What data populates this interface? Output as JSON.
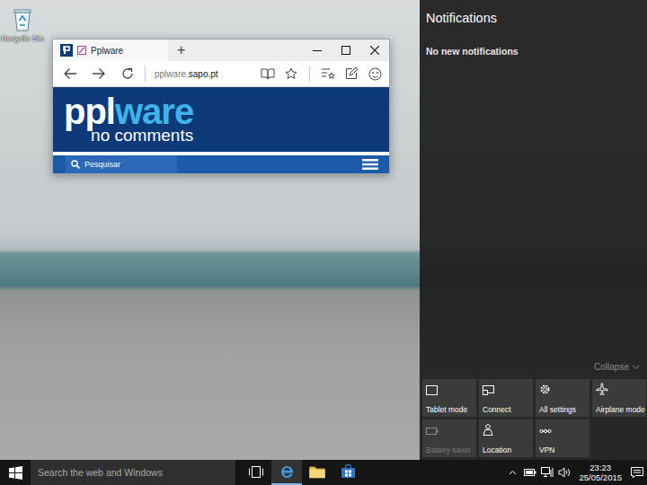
{
  "desktop": {
    "icons": [
      {
        "label": "Recycle Bin"
      }
    ]
  },
  "browser": {
    "tab": {
      "title": "Pplware"
    },
    "new_tab": "+",
    "address": {
      "subdomain": "pplware.",
      "domain": "sapo.pt"
    },
    "page": {
      "logo_a": "ppl",
      "logo_b": "ware",
      "tagline": "no comments",
      "search": "Pesquisar"
    }
  },
  "action_center": {
    "title": "Notifications",
    "empty": "No new notifications",
    "collapse": "Collapse",
    "tiles": [
      {
        "label": "Tablet mode",
        "kind": "tablet",
        "disabled": false
      },
      {
        "label": "Connect",
        "kind": "connect",
        "disabled": false
      },
      {
        "label": "All settings",
        "kind": "settings",
        "disabled": false
      },
      {
        "label": "Airplane mode",
        "kind": "airplane",
        "disabled": false
      },
      {
        "label": "Battery saver",
        "kind": "battery",
        "disabled": true
      },
      {
        "label": "Location",
        "kind": "location",
        "disabled": false
      },
      {
        "label": "VPN",
        "kind": "vpn",
        "disabled": false
      }
    ]
  },
  "taskbar": {
    "search": "Search the web and Windows",
    "apps": [
      {
        "kind": "taskview",
        "selected": false
      },
      {
        "kind": "edge",
        "selected": true
      },
      {
        "kind": "explorer",
        "selected": false
      },
      {
        "kind": "store",
        "selected": false
      }
    ],
    "time": "23:23",
    "date": "25/05/2015"
  }
}
